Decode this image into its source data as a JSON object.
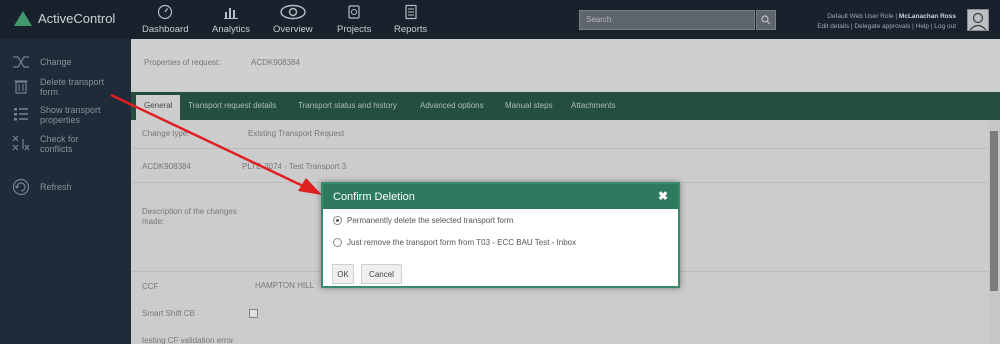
{
  "app": {
    "name": "ActiveControl"
  },
  "nav": [
    {
      "label": "Dashboard",
      "icon": "gauge-icon"
    },
    {
      "label": "Analytics",
      "icon": "bar-chart-icon"
    },
    {
      "label": "Overview",
      "icon": "eye-icon"
    },
    {
      "label": "Projects",
      "icon": "projects-icon"
    },
    {
      "label": "Reports",
      "icon": "report-icon"
    }
  ],
  "search": {
    "placeholder": "Search"
  },
  "user": {
    "role_prefix": "Default Web User Role |",
    "name": "McLanachan Ross",
    "links": "Edit details | Delegate approvals | Help | Log out"
  },
  "sidebar": {
    "items": [
      {
        "label": "Change",
        "icon": "shuffle-icon"
      },
      {
        "label": "Delete transport form",
        "icon": "trash-icon"
      },
      {
        "label": "Show transport properties",
        "icon": "list-icon"
      },
      {
        "label": "Check for conflicts",
        "icon": "conflict-icon"
      },
      {
        "label": "Refresh",
        "icon": "refresh-icon"
      }
    ]
  },
  "properties": {
    "label": "Properties of request:",
    "value": "ACDK908384"
  },
  "tabs": [
    "General",
    "Transport request details",
    "Transport status and history",
    "Advanced options",
    "Manual steps",
    "Attachments"
  ],
  "form": {
    "change_type_label": "Change type:",
    "change_type_value": "Existing Transport Request",
    "request_id": "ACDK908384",
    "request_desc": "PLTE-3074 - Test Transport 3",
    "description_label": "Description of the changes made:",
    "ccf_label": "CCF",
    "ccf_value": "HAMPTON HILL",
    "smart_shift_label": "Smart Shift CB",
    "testing_label": "testing CF validation error"
  },
  "dialog": {
    "title": "Confirm Deletion",
    "close": "✖",
    "options": [
      "Permanently delete the selected transport form",
      "Just remove the transport form from T03 - ECC BAU Test - Inbox"
    ],
    "selected_index": 0,
    "ok_label": "OK",
    "cancel_label": "Cancel"
  },
  "colors": {
    "topbar": "#1d2733",
    "sidebar": "#243140",
    "tabs": "#2a5b48",
    "dialog_header": "#2e7a5e",
    "arrow": "#e02020"
  }
}
